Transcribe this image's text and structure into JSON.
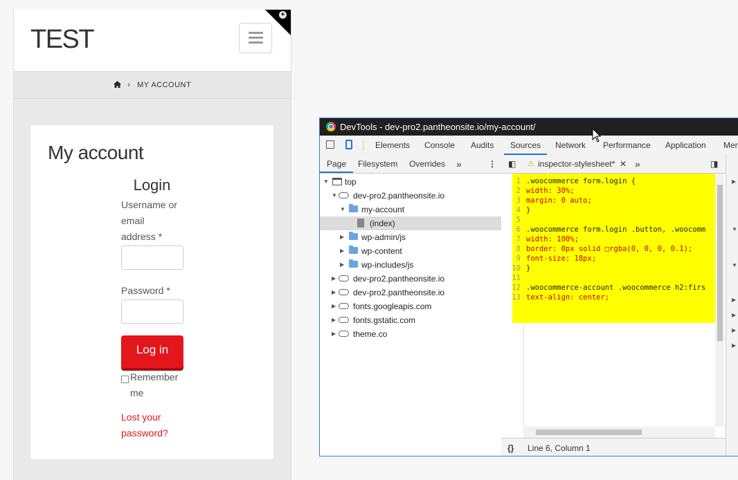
{
  "site": {
    "logo": "TEST",
    "breadcrumb": {
      "home_icon": "home-icon",
      "separator": "›",
      "current": "MY ACCOUNT"
    },
    "page_title": "My account",
    "login_title": "Login",
    "username_label_lines": [
      "Username or",
      "email",
      "address *"
    ],
    "password_label": "Password *",
    "login_button": "Log in",
    "remember_lines": [
      "Remember",
      "me"
    ],
    "lost_password_lines": [
      "Lost your",
      "password?"
    ],
    "accent_color": "#e3161c"
  },
  "devtools": {
    "title": "DevTools - dev-pro2.pantheonsite.io/my-account/",
    "tabs": [
      "Elements",
      "Console",
      "Audits",
      "Sources",
      "Network",
      "Performance",
      "Application",
      "Mem"
    ],
    "active_tab": "Sources",
    "navigator_tabs": [
      "Page",
      "Filesystem",
      "Overrides",
      "»"
    ],
    "tree": [
      {
        "label": "top",
        "icon": "frame-icon",
        "expanded": true
      },
      {
        "label": "dev-pro2.pantheonsite.io",
        "icon": "cloud-icon",
        "expanded": true
      },
      {
        "label": "my-account",
        "icon": "folder-icon",
        "expanded": true
      },
      {
        "label": "(index)",
        "icon": "file-icon",
        "selected": true
      },
      {
        "label": "wp-admin/js",
        "icon": "folder-icon"
      },
      {
        "label": "wp-content",
        "icon": "folder-icon"
      },
      {
        "label": "wp-includes/js",
        "icon": "folder-icon"
      },
      {
        "label": "dev-pro2.pantheonsite.io",
        "icon": "cloud-icon"
      },
      {
        "label": "dev-pro2.pantheonsite.io",
        "icon": "cloud-icon"
      },
      {
        "label": "fonts.googleapis.com",
        "icon": "cloud-icon"
      },
      {
        "label": "fonts.gstatic.com",
        "icon": "cloud-icon"
      },
      {
        "label": "theme.co",
        "icon": "cloud-icon"
      }
    ],
    "editor_tab": "inspector-stylesheet*",
    "code_lines": [
      ".woocommerce form.login {",
      "width: 30%;",
      "margin: 0 auto;",
      "}",
      "",
      ".woocommerce form.login .button, .woocomm",
      "width: 100%;",
      "border: 0px solid □rgba(0, 0, 0, 0.1);",
      "font-size: 18px;",
      "}",
      "",
      ".woocommerce-account .woocommerce h2:firs",
      "text-align: center;"
    ],
    "status": "Line 6, Column 1",
    "highlight_color": "#ffff00"
  }
}
